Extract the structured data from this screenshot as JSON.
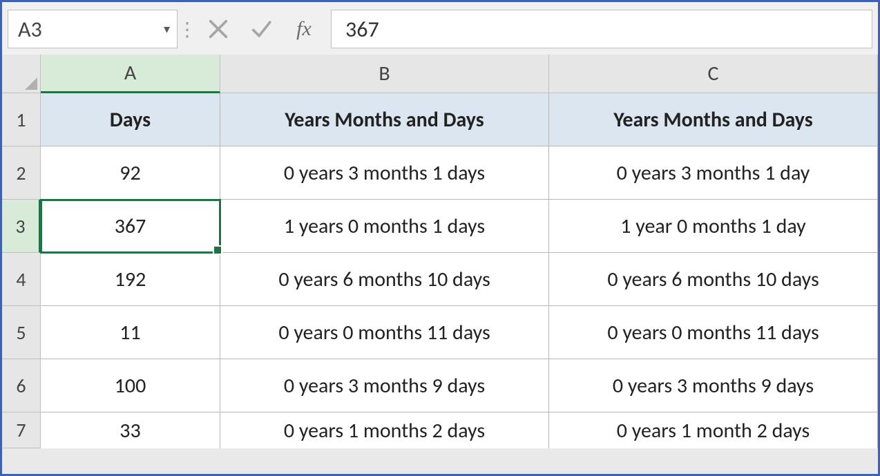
{
  "formula_bar": {
    "name_box": "A3",
    "dropdown_glyph": "▾",
    "cancel_icon": "cancel-icon",
    "accept_icon": "accept-icon",
    "fx_label": "fx",
    "formula_value": "367"
  },
  "column_headers": [
    "A",
    "B",
    "C"
  ],
  "row_numbers": [
    "1",
    "2",
    "3",
    "4",
    "5",
    "6",
    "7"
  ],
  "table_header": {
    "a": "Days",
    "b": "Years Months and Days",
    "c": "Years Months and Days"
  },
  "rows": [
    {
      "a": "92",
      "b": "0 years 3 months 1 days",
      "c": "0 years 3 months 1 day"
    },
    {
      "a": "367",
      "b": "1 years 0 months 1 days",
      "c": "1 year 0 months 1 day"
    },
    {
      "a": "192",
      "b": "0 years 6 months 10 days",
      "c": "0 years 6 months 10 days"
    },
    {
      "a": "11",
      "b": "0 years 0 months 11 days",
      "c": "0 years 0 months 11 days"
    },
    {
      "a": "100",
      "b": "0 years 3 months 9 days",
      "c": "0 years 3 months 9 days"
    },
    {
      "a": "33",
      "b": "0 years 1 months 2 days",
      "c": "0 years 1 month 2 days"
    }
  ],
  "selection": {
    "cell": "A3",
    "row_index": 1
  }
}
